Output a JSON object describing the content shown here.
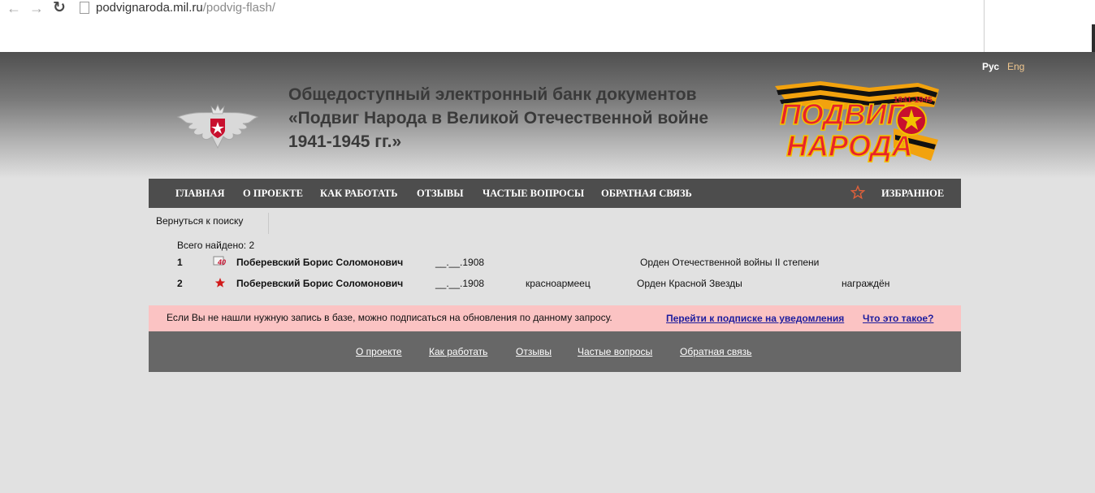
{
  "browser": {
    "back_icon": "arrow-left-icon",
    "forward_icon": "arrow-right-icon",
    "reload_icon": "reload-icon",
    "url_domain": "podvignaroda.mil.ru",
    "url_path": "/podvig-flash/"
  },
  "header": {
    "lang_ru": "Рус",
    "lang_en": "Eng",
    "title_line1": "Общедоступный электронный банк документов",
    "title_line2": "«Подвиг Народа в Великой Отечественной войне",
    "title_line3": "1941-1945 гг.»",
    "logo_text_top": "ПОДВИГ",
    "logo_text_bottom": "НАРОДА",
    "logo_years": "1941-1945"
  },
  "nav": {
    "items": [
      "ГЛАВНАЯ",
      "О ПРОЕКТЕ",
      "КАК РАБОТАТЬ",
      "ОТЗЫВЫ",
      "ЧАСТЫЕ ВОПРОСЫ",
      "ОБРАТНАЯ СВЯЗЬ"
    ],
    "favorites": "ИЗБРАННОЕ",
    "favorites_icon": "star-outline-icon"
  },
  "back_to_search": "Вернуться к поиску",
  "results": {
    "total_label": "Всего найдено: 2",
    "rows": [
      {
        "num": "1",
        "icon": "order-patriotic-war-icon",
        "name": "Поберевский Борис Соломонович",
        "birth": "__.__.1908",
        "rank": "",
        "award": "Орден Отечественной войны II степени",
        "status": ""
      },
      {
        "num": "2",
        "icon": "red-star-icon",
        "name": "Поберевский Борис Соломонович",
        "birth": "__.__.1908",
        "rank": "красноармеец",
        "award": "Орден Красной Звезды",
        "status": "награждён"
      }
    ]
  },
  "subscribe": {
    "text": "Если Вы не нашли нужную запись в базе, можно подписаться на обновления по данному запросу.",
    "link_subscribe": "Перейти к подписке на уведомления",
    "link_what": "Что это такое?"
  },
  "footer": {
    "links": [
      "О проекте",
      "Как работать",
      "Отзывы",
      "Частые вопросы",
      "Обратная связь"
    ]
  },
  "colors": {
    "nav_bg": "#4d4d4d",
    "footer_bg": "#676767",
    "subscribe_bg": "#fbc3c3",
    "page_bg": "#e1e1e1",
    "link_blue": "#1d1d9e",
    "lang_en": "#f0c78f"
  }
}
